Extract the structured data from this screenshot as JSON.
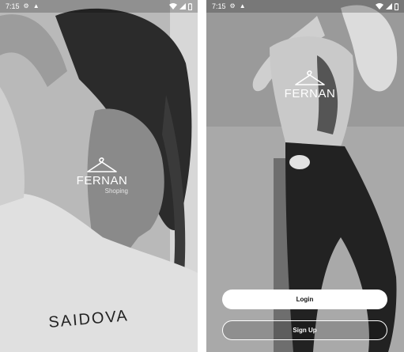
{
  "screens": [
    {
      "status_bar": {
        "time": "7:15"
      },
      "logo": {
        "brand": "FERNAN",
        "tagline": "Shoping"
      },
      "photo": {
        "shirt_text": "SAIDOVA"
      }
    },
    {
      "status_bar": {
        "time": "7:15"
      },
      "logo": {
        "brand": "FERNAN"
      },
      "buttons": {
        "login_label": "Login",
        "signup_label": "Sign Up"
      }
    }
  ],
  "icons": {
    "status_left": [
      "gear-icon",
      "notification-icon"
    ],
    "status_right": [
      "wifi-icon",
      "signal-icon",
      "battery-icon"
    ],
    "logo": "hanger-icon"
  },
  "colors": {
    "text": "#ffffff",
    "button_fill": "#ffffff",
    "button_text": "#111111"
  }
}
